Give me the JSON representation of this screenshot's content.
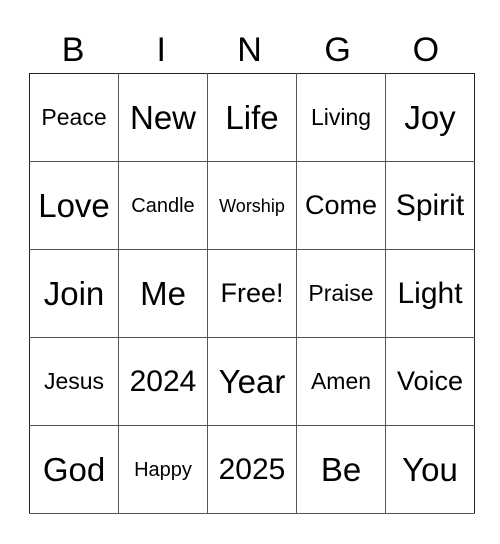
{
  "header": {
    "letters": [
      "B",
      "I",
      "N",
      "G",
      "O"
    ]
  },
  "grid": {
    "rows": [
      [
        "Peace",
        "New",
        "Life",
        "Living",
        "Joy"
      ],
      [
        "Love",
        "Candle",
        "Worship",
        "Come",
        "Spirit"
      ],
      [
        "Join",
        "Me",
        "Free!",
        "Praise",
        "Light"
      ],
      [
        "Jesus",
        "2024",
        "Year",
        "Amen",
        "Voice"
      ],
      [
        "God",
        "Happy",
        "2025",
        "Be",
        "You"
      ]
    ],
    "free_space": "Free!"
  }
}
